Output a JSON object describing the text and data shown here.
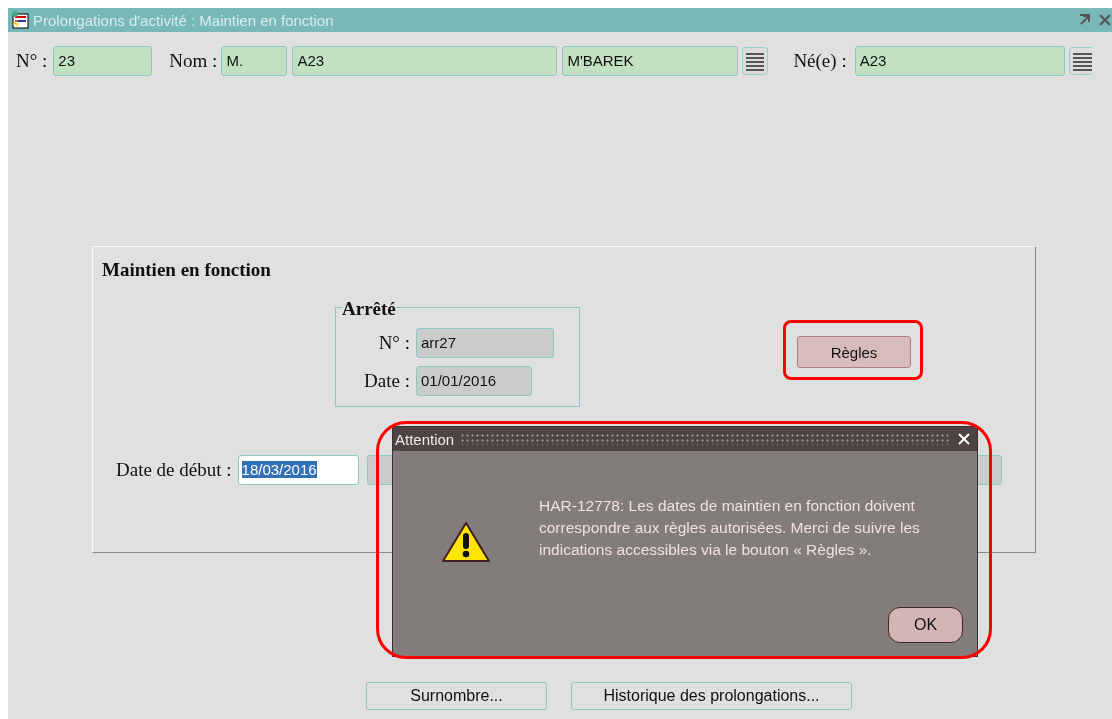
{
  "window": {
    "title": "Prolongations d'activité : Maintien en fonction"
  },
  "header": {
    "number": {
      "label": "N° :",
      "value": "23"
    },
    "name": {
      "label": "Nom :",
      "civility": "M.",
      "first": "A23",
      "last": "M'BAREK"
    },
    "born": {
      "label": "Né(e) :",
      "value": "A23"
    }
  },
  "panel": {
    "title": "Maintien en fonction",
    "arrete": {
      "title": "Arrêté",
      "fields": [
        {
          "label": "N° :",
          "value": "arr27",
          "readonly": true
        },
        {
          "label": "Date :",
          "value": "01/01/2016",
          "readonly": true
        }
      ]
    },
    "rules_button": "Règles",
    "start_date": {
      "label": "Date de début :",
      "value": "18/03/2016",
      "selected": true
    }
  },
  "buttons": [
    "Surnombre...",
    "Historique des prolongations..."
  ],
  "dialog": {
    "title": "Attention",
    "message": "HAR-12778: Les dates de maintien en fonction doivent correspondre aux règles autorisées. Merci de suivre les indications accessibles via le bouton « Règles ».",
    "ok": "OK"
  }
}
